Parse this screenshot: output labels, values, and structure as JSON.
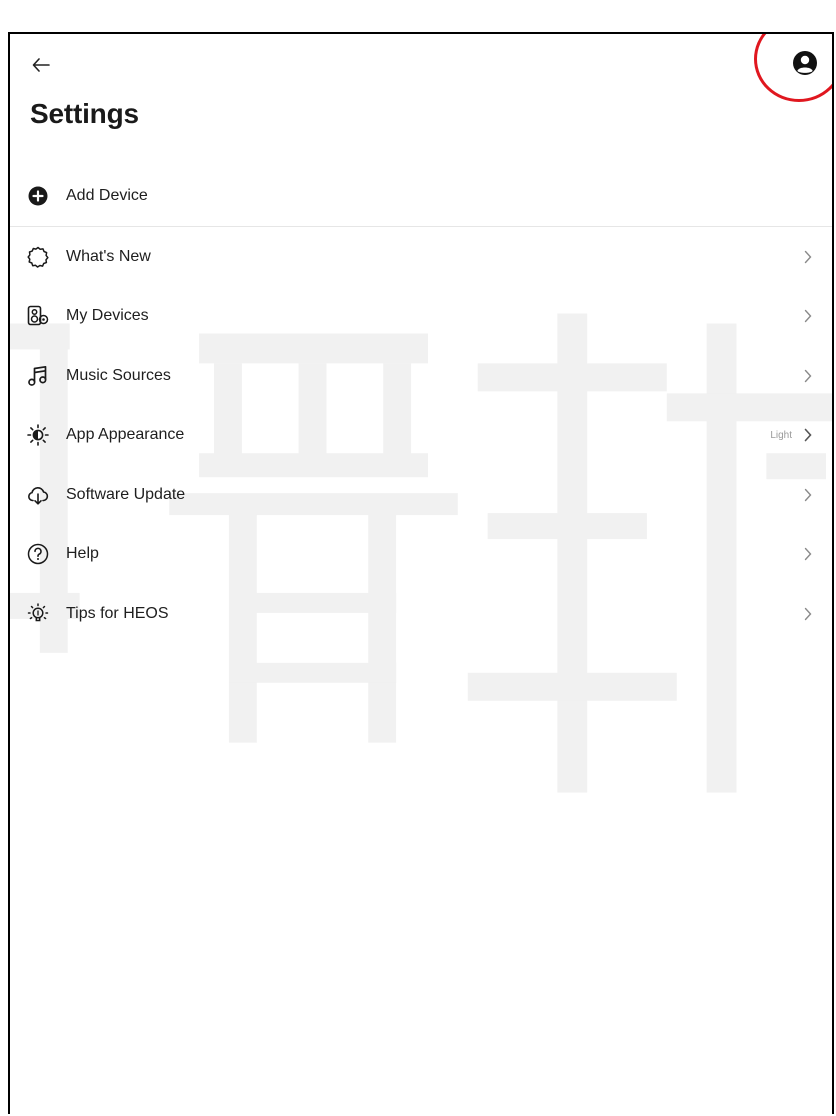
{
  "header": {
    "title": "Settings",
    "back_icon": "arrow-left-icon",
    "account_icon": "account-circle-icon"
  },
  "menu": {
    "items": [
      {
        "label": "Add Device",
        "icon": "add-circle-icon",
        "chevron": false
      },
      {
        "label": "What's New",
        "icon": "new-badge-icon",
        "chevron": true
      },
      {
        "label": "My Devices",
        "icon": "speaker-icon",
        "chevron": true
      },
      {
        "label": "Music Sources",
        "icon": "music-note-icon",
        "chevron": true
      },
      {
        "label": "App Appearance",
        "icon": "appearance-icon",
        "chevron": true,
        "value": "Light"
      },
      {
        "label": "Software Update",
        "icon": "cloud-download-icon",
        "chevron": true
      },
      {
        "label": "Help",
        "icon": "help-circle-icon",
        "chevron": true
      },
      {
        "label": "Tips for HEOS",
        "icon": "lightbulb-icon",
        "chevron": true
      }
    ]
  },
  "colors": {
    "highlight_ring": "#e0171f",
    "text": "#1e1e1e",
    "divider": "#e6e6e6",
    "chevron": "#8a8a8a"
  }
}
